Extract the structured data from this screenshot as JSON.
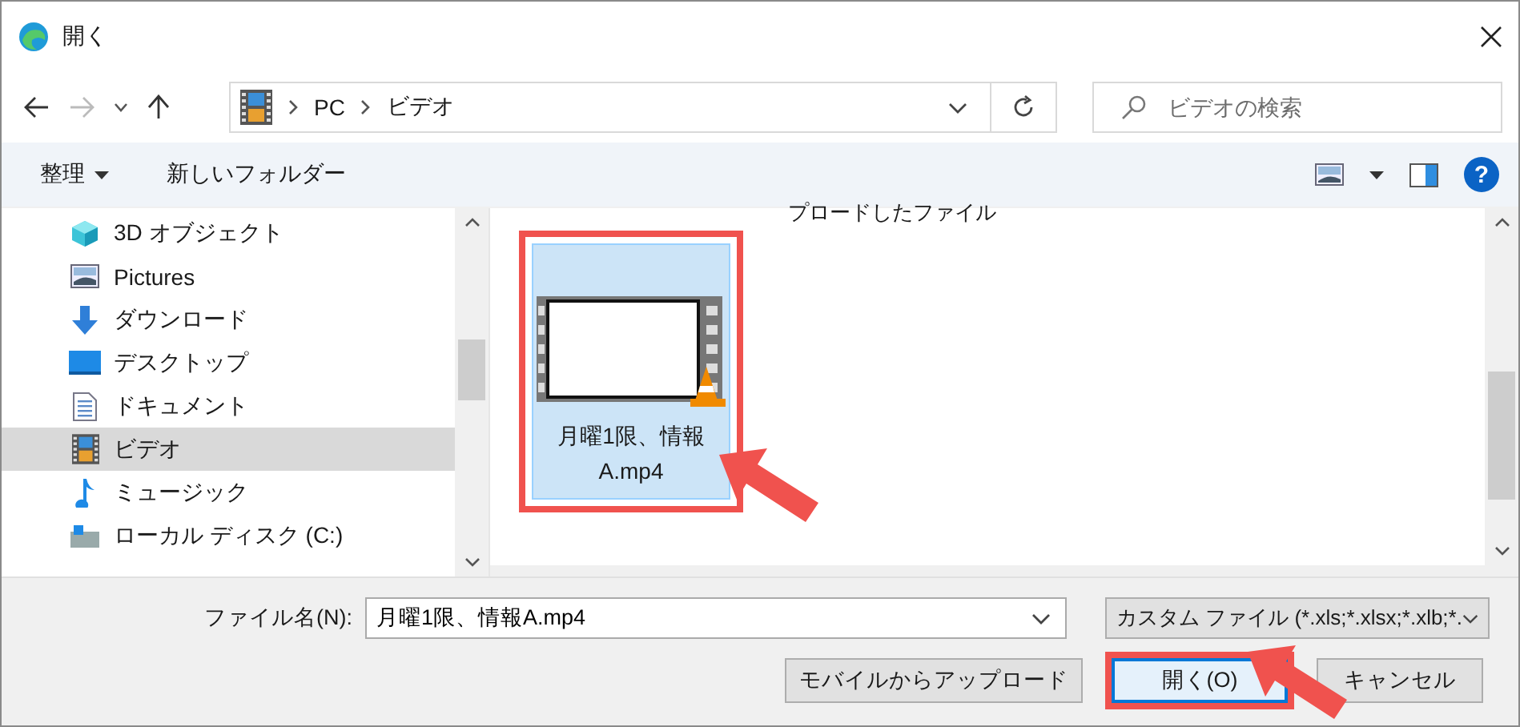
{
  "window": {
    "title": "開く"
  },
  "nav": {
    "path": [
      "PC",
      "ビデオ"
    ],
    "search": {
      "placeholder": "ビデオの検索"
    }
  },
  "toolbar": {
    "organize": "整理",
    "new_folder": "新しいフォルダー",
    "help": "?"
  },
  "sidebar": {
    "items": [
      {
        "label": "3D オブジェクト",
        "kind": "cube",
        "selected": false
      },
      {
        "label": "Pictures",
        "kind": "pictures",
        "selected": false
      },
      {
        "label": "ダウンロード",
        "kind": "download",
        "selected": false
      },
      {
        "label": "デスクトップ",
        "kind": "desktop",
        "selected": false
      },
      {
        "label": "ドキュメント",
        "kind": "document",
        "selected": false
      },
      {
        "label": "ビデオ",
        "kind": "video",
        "selected": true
      },
      {
        "label": "ミュージック",
        "kind": "music",
        "selected": false
      },
      {
        "label": "ローカル ディスク (C:)",
        "kind": "drive",
        "selected": false
      }
    ]
  },
  "content": {
    "group_heading": "プロードしたファイル",
    "files": [
      {
        "name": "月曜1限、情報A.mp4",
        "selected": true,
        "highlighted": true
      }
    ]
  },
  "footer": {
    "filename_label": "ファイル名(N):",
    "filename": "月曜1限、情報A.mp4",
    "filetype": "カスタム ファイル (*.xls;*.xlsx;*.xlb;*.",
    "buttons": [
      {
        "label": "モバイルからアップロード",
        "kind": "secondary",
        "highlighted": false
      },
      {
        "label": "開く(O)",
        "kind": "primary",
        "highlighted": true
      },
      {
        "label": "キャンセル",
        "kind": "secondary",
        "highlighted": false
      }
    ]
  }
}
